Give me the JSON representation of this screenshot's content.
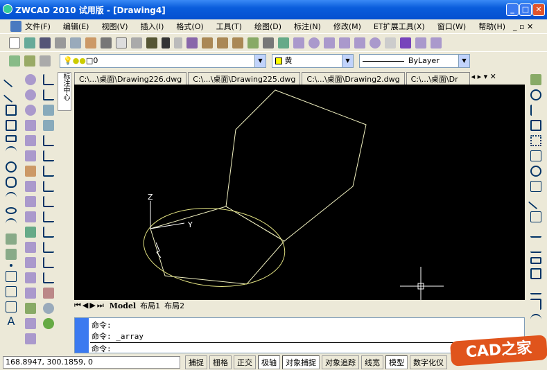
{
  "window": {
    "title": "ZWCAD 2010 试用版 - [Drawing4]"
  },
  "menu": [
    "文件(F)",
    "编辑(E)",
    "视图(V)",
    "插入(I)",
    "格式(O)",
    "工具(T)",
    "绘图(D)",
    "标注(N)",
    "修改(M)",
    "ET扩展工具(X)",
    "窗口(W)",
    "帮助(H)"
  ],
  "layer_combo": {
    "value": "0"
  },
  "color_combo": {
    "value": "黄",
    "swatch": "#ffff00"
  },
  "linetype_combo": {
    "value": "ByLayer"
  },
  "doc_tabs": [
    "C:\\...\\桌面\\Drawing226.dwg",
    "C:\\...\\桌面\\Drawing225.dwg",
    "C:\\...\\桌面\\Drawing2.dwg",
    "C:\\...\\桌面\\Dr"
  ],
  "side_tab": "标注中心",
  "ucs": {
    "z": "Z",
    "y": "Y"
  },
  "layout_tabs": [
    "Model",
    "布局1",
    "布局2"
  ],
  "command": {
    "lines": [
      "命令:",
      "命令: _array",
      "命令:"
    ]
  },
  "status": {
    "coords": "168.8947,  300.1859,  0",
    "buttons": [
      {
        "label": "捕捉",
        "on": false
      },
      {
        "label": "栅格",
        "on": false
      },
      {
        "label": "正交",
        "on": false
      },
      {
        "label": "极轴",
        "on": true
      },
      {
        "label": "对象捕捉",
        "on": true
      },
      {
        "label": "对象追踪",
        "on": false
      },
      {
        "label": "线宽",
        "on": false
      },
      {
        "label": "模型",
        "on": true
      },
      {
        "label": "数字化仪",
        "on": false
      }
    ]
  },
  "watermark": "CAD之家",
  "colors": {
    "drawing_bg": "#000000",
    "entity": "#ffffc0",
    "ellipse": "#e0e080"
  }
}
